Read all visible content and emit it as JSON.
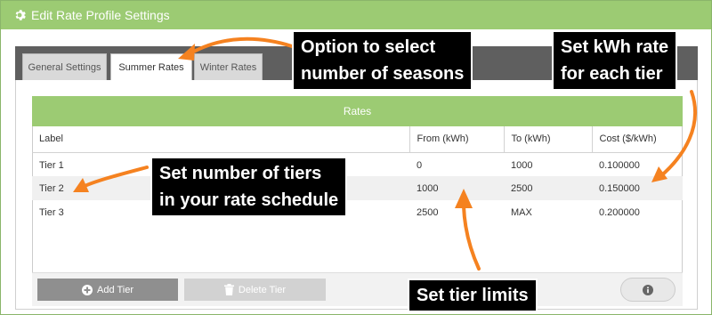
{
  "window": {
    "title": "Edit Rate Profile Settings"
  },
  "tabs": [
    {
      "label": "General Settings",
      "active": false
    },
    {
      "label": "Summer Rates",
      "active": true
    },
    {
      "label": "Winter Rates",
      "active": false
    }
  ],
  "rates": {
    "header": "Rates",
    "columns": [
      "Label",
      "From (kWh)",
      "To (kWh)",
      "Cost ($/kWh)"
    ],
    "rows": [
      {
        "label": "Tier 1",
        "from": "0",
        "to": "1000",
        "cost": "0.100000"
      },
      {
        "label": "Tier 2",
        "from": "1000",
        "to": "2500",
        "cost": "0.150000"
      },
      {
        "label": "Tier 3",
        "from": "2500",
        "to": "MAX",
        "cost": "0.200000"
      }
    ]
  },
  "footer": {
    "add_label": "Add Tier",
    "delete_label": "Delete Tier"
  },
  "callouts": {
    "seasons": [
      "Option to select",
      "number of seasons"
    ],
    "kwh_rate": [
      "Set kWh rate",
      "for each tier"
    ],
    "tiers": [
      "Set number of tiers",
      "in your rate schedule"
    ],
    "limits": "Set tier limits"
  },
  "colors": {
    "accent_green": "#9ccb73",
    "arrow_orange": "#f58220",
    "tabs_bg": "#5f5f5f"
  }
}
